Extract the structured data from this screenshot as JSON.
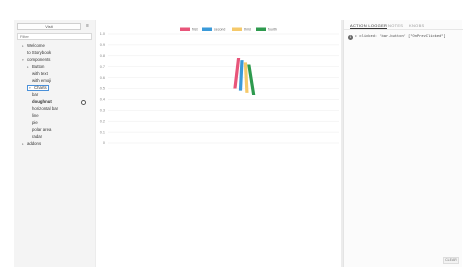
{
  "sidebar": {
    "title": "Visit",
    "menu_icon": "hamburger-icon",
    "filter_placeholder": "Filter",
    "items": [
      {
        "label": "Welcome",
        "indent": 1,
        "arrow": "▸",
        "bold": false
      },
      {
        "label": "to Storybook",
        "indent": 2,
        "arrow": "",
        "bold": false
      },
      {
        "label": "components",
        "indent": 1,
        "arrow": "▾",
        "bold": false
      },
      {
        "label": "Button",
        "indent": 2,
        "arrow": "▸",
        "bold": false
      },
      {
        "label": "with text",
        "indent": 3,
        "arrow": "",
        "bold": false
      },
      {
        "label": "with emoji",
        "indent": 3,
        "arrow": "",
        "bold": false
      },
      {
        "label": "Charts",
        "indent": 2,
        "arrow": "▾",
        "bold": false,
        "selected": true
      },
      {
        "label": "bar",
        "indent": 3,
        "arrow": "",
        "bold": false
      },
      {
        "label": "doughnut",
        "indent": 3,
        "arrow": "",
        "bold": true
      },
      {
        "label": "horizontal bar",
        "indent": 3,
        "arrow": "",
        "bold": false
      },
      {
        "label": "line",
        "indent": 3,
        "arrow": "",
        "bold": false
      },
      {
        "label": "pie",
        "indent": 3,
        "arrow": "",
        "bold": false
      },
      {
        "label": "polar area",
        "indent": 3,
        "arrow": "",
        "bold": false
      },
      {
        "label": "radar",
        "indent": 3,
        "arrow": "",
        "bold": false
      },
      {
        "label": "addons",
        "indent": 1,
        "arrow": "▸",
        "bold": false
      }
    ]
  },
  "addon_panel": {
    "tabs": [
      {
        "label": "ACTION LOGGER",
        "active": true
      },
      {
        "label": "NOTES",
        "active": false
      },
      {
        "label": "KNOBS",
        "active": false
      }
    ],
    "log": {
      "count": "1",
      "text": "▸ clicked: 'bar-button' [\"OnPrevClicked\"]"
    },
    "clear_label": "CLEAR"
  },
  "chart_data": {
    "type": "bar",
    "title": "",
    "xlabel": "",
    "ylabel": "",
    "ylim": [
      0,
      1
    ],
    "y_ticks": [
      "1.0",
      "0.9",
      "0.8",
      "0.7",
      "0.6",
      "0.5",
      "0.4",
      "0.3",
      "0.2",
      "0.1",
      "0"
    ],
    "grid": true,
    "legend_placement": "top-center",
    "series": [
      {
        "name": "first",
        "color": "#e8557a",
        "value": 0.78
      },
      {
        "name": "second",
        "color": "#3a9ad9",
        "value": 0.76
      },
      {
        "name": "third",
        "color": "#f5c96a",
        "value": 0.74
      },
      {
        "name": "fourth",
        "color": "#2e9a4e",
        "value": 0.72
      }
    ],
    "note": "bars rendered mid-animation (skewed)"
  }
}
